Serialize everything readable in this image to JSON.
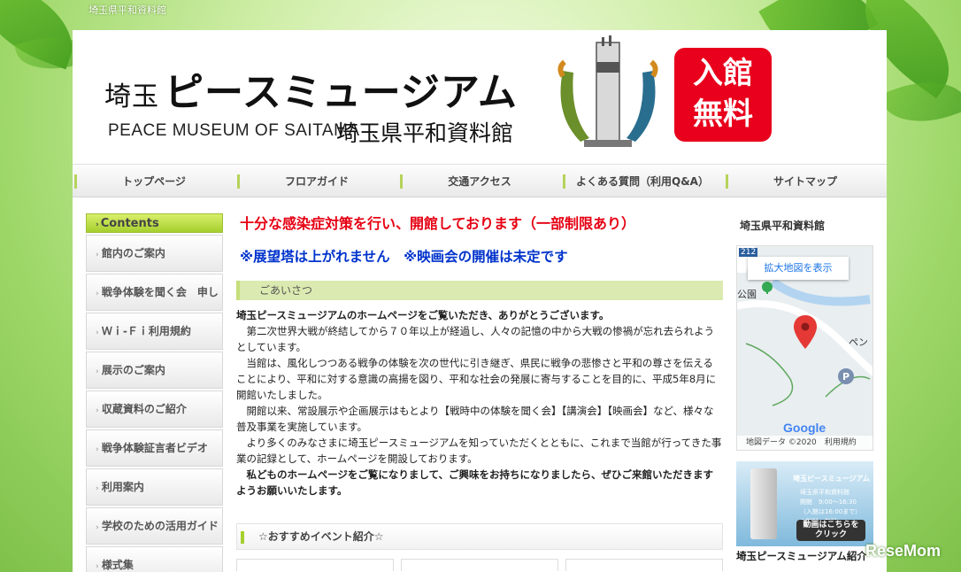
{
  "browser_strip": {
    "title": "埼玉県平和資料館"
  },
  "header": {
    "logo_prefix": "埼玉",
    "logo_main": "ピースミュージアム",
    "logo_en": "PEACE MUSEUM OF SAITAMA",
    "logo_jp2": "埼玉県平和資料館",
    "badge_line1": "入館",
    "badge_line2": "無料"
  },
  "nav": {
    "items": [
      "トップページ",
      "フロアガイド",
      "交通アクセス",
      "よくある質問（利用Q&A）",
      "サイトマップ"
    ]
  },
  "sidebar": {
    "heading": "Contents",
    "items": [
      "館内のご案内",
      "戦争体験を聞く会　申し",
      "Ｗｉ-Ｆｉ利用規約",
      "展示のご案内",
      "収蔵資料のご紹介",
      "戦争体験証言者ビデオ",
      "利用案内",
      "学校のための活用ガイド",
      "様式集"
    ]
  },
  "main": {
    "alert1": "十分な感染症対策を行い、開館しております（一部制限あり）",
    "alert2": "※展望塔は上がれません　※映画会の開催は未定です",
    "greeting_heading": "ごあいさつ",
    "greeting": [
      "埼玉ピースミュージアムのホームページをご覧いただき、ありがとうございます。",
      "　第二次世界大戦が終結してから７０年以上が経過し、人々の記憶の中から大戦の惨禍が忘れ去られようとしています。",
      "　当館は、風化しつつある戦争の体験を次の世代に引き継ぎ、県民に戦争の悲惨さと平和の尊さを伝えることにより、平和に対する意識の高揚を図り、平和な社会の発展に寄与することを目的に、平成5年8月に開館いたしました。",
      "　開館以来、常設展示や企画展示はもとより【戦時中の体験を聞く会】【講演会】【映画会】など、様々な普及事業を実施しています。",
      "　より多くのみなさまに埼玉ピースミュージアムを知っていただくとともに、これまで当館が行ってきた事業の記録として、ホームページを開設しております。",
      "　私どものホームページをご覧になりまして、ご興味をお持ちになりましたら、ぜひご来館いただきますようお願いいたします。"
    ],
    "recommend_heading": "☆おすすめイベント紹介☆"
  },
  "right": {
    "title": "埼玉県平和資料館",
    "map_button": "拡大地図を表示",
    "map_road": "212",
    "map_label_left": "公園",
    "map_label_right": "ペン",
    "map_google": "Google",
    "map_footer": "地図データ ©2020　利用規約",
    "banner_title": "埼玉ピースミュージアム",
    "banner_sub": "埼玉県平和資料館",
    "banner_hours": "開館　9:00〜16:30",
    "banner_hours_note": "（入館は16:00まで）",
    "banner_fee": "入館料　無料",
    "banner_btn_line1": "動画はこちらを",
    "banner_btn_line2": "クリック",
    "banner_caption": "埼玉ピースミュージアム紹介"
  },
  "watermark": "ReseMom",
  "colors": {
    "alert_red": "#e60012",
    "alert_blue": "#0033cc",
    "accent_green": "#a6cf2e"
  }
}
